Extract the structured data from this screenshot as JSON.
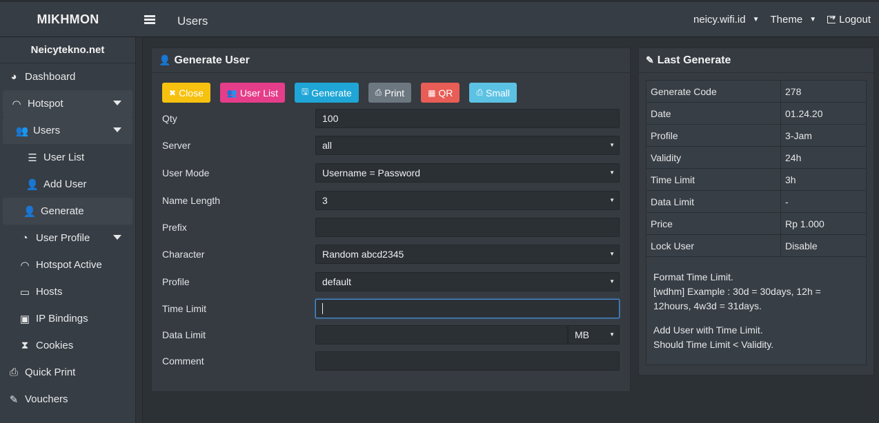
{
  "brand": "MIKHMON",
  "header": {
    "title": "Users",
    "session": "neicy.wifi.id",
    "theme": "Theme",
    "logout": "Logout"
  },
  "sidebar": {
    "site_name": "Neicytekno.net",
    "items": [
      {
        "label": "Dashboard",
        "icon": "dashboard-icon"
      },
      {
        "label": "Hotspot",
        "icon": "wifi-icon"
      },
      {
        "label": "Users",
        "icon": "users-icon"
      },
      {
        "label": "User List",
        "icon": "list-icon"
      },
      {
        "label": "Add User",
        "icon": "add-user-icon"
      },
      {
        "label": "Generate",
        "icon": "add-user-icon"
      },
      {
        "label": "User Profile",
        "icon": "pie-chart-icon"
      },
      {
        "label": "Hotspot Active",
        "icon": "wifi-icon"
      },
      {
        "label": "Hosts",
        "icon": "laptop-icon"
      },
      {
        "label": "IP Bindings",
        "icon": "address-card-icon"
      },
      {
        "label": "Cookies",
        "icon": "hourglass-icon"
      },
      {
        "label": "Quick Print",
        "icon": "print-icon"
      },
      {
        "label": "Vouchers",
        "icon": "ticket-icon"
      }
    ]
  },
  "generate": {
    "title": "Generate User",
    "buttons": {
      "close": "Close",
      "user_list": "User List",
      "generate": "Generate",
      "print": "Print",
      "qr": "QR",
      "small": "Small"
    },
    "fields": {
      "qty_label": "Qty",
      "qty_value": "100",
      "server_label": "Server",
      "server_value": "all",
      "user_mode_label": "User Mode",
      "user_mode_value": "Username = Password",
      "name_length_label": "Name Length",
      "name_length_value": "3",
      "prefix_label": "Prefix",
      "prefix_value": "",
      "character_label": "Character",
      "character_value": "Random abcd2345",
      "profile_label": "Profile",
      "profile_value": "default",
      "time_limit_label": "Time Limit",
      "time_limit_value": "",
      "data_limit_label": "Data Limit",
      "data_limit_value": "",
      "data_limit_unit": "MB",
      "comment_label": "Comment",
      "comment_value": ""
    }
  },
  "last_generate": {
    "title": "Last Generate",
    "rows": [
      {
        "key": "Generate Code",
        "value": "278"
      },
      {
        "key": "Date",
        "value": "01.24.20"
      },
      {
        "key": "Profile",
        "value": "3-Jam"
      },
      {
        "key": "Validity",
        "value": "24h"
      },
      {
        "key": "Time Limit",
        "value": "3h"
      },
      {
        "key": "Data Limit",
        "value": "-"
      },
      {
        "key": "Price",
        "value": "Rp 1.000"
      },
      {
        "key": "Lock User",
        "value": "Disable"
      }
    ],
    "note1_line1": "Format Time Limit.",
    "note1_line2": "[wdhm] Example : 30d = 30days, 12h = 12hours, 4w3d = 31days.",
    "note2_line1": "Add User with Time Limit.",
    "note2_line2": "Should Time Limit < Validity."
  }
}
